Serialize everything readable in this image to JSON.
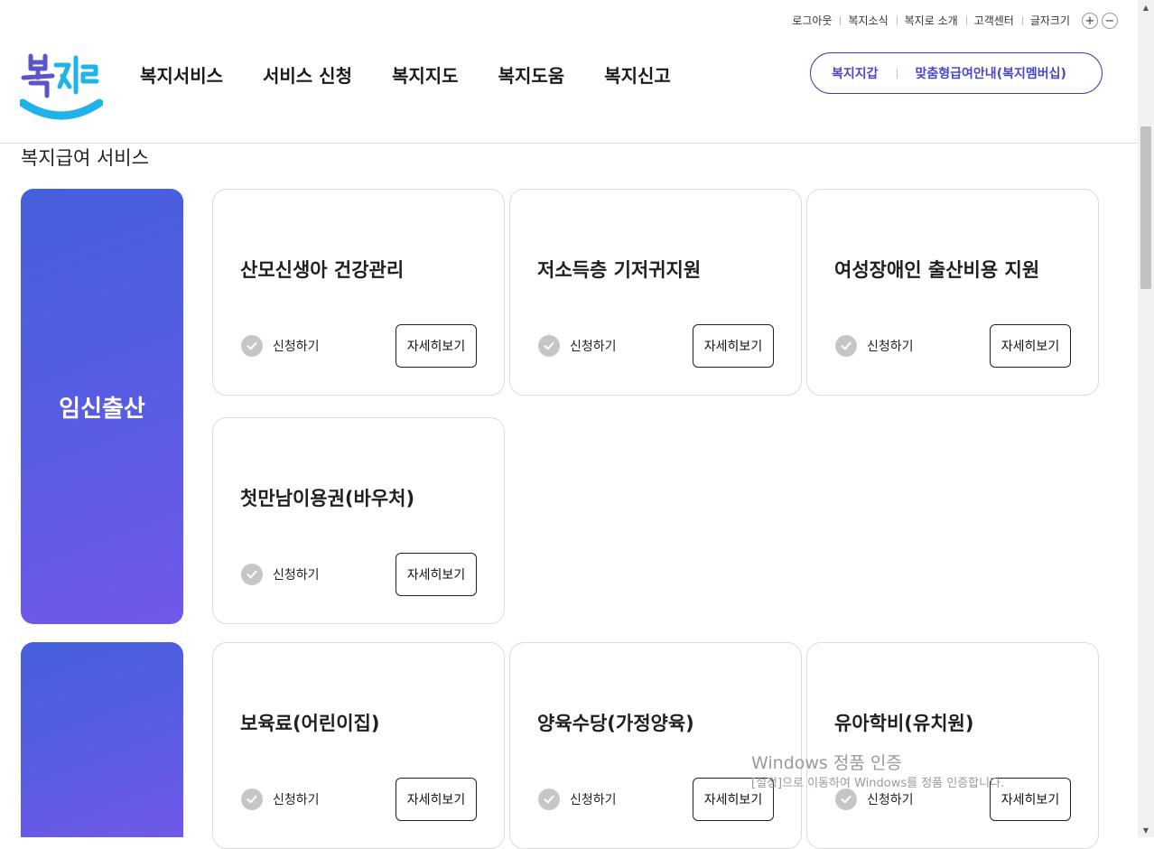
{
  "util": {
    "logout": "로그아웃",
    "news": "복지소식",
    "about": "복지로 소개",
    "support": "고객센터",
    "font_size": "글자크기",
    "plus": "+",
    "minus": "−"
  },
  "logo": {
    "text": "복지로"
  },
  "gnb": {
    "items": [
      "복지서비스",
      "서비스 신청",
      "복지지도",
      "복지도움",
      "복지신고"
    ]
  },
  "pill": {
    "wallet": "복지지갑",
    "membership": "맞춤형급여안내(복지멤버십)"
  },
  "section": {
    "title": "복지급여 서비스"
  },
  "categories": [
    {
      "name": "임신출산",
      "cards": [
        {
          "title": "산모신생아 건강관리",
          "apply": "신청하기",
          "detail": "자세히보기"
        },
        {
          "title": "저소득층 기저귀지원",
          "apply": "신청하기",
          "detail": "자세히보기"
        },
        {
          "title": "여성장애인 출산비용 지원",
          "apply": "신청하기",
          "detail": "자세히보기"
        },
        {
          "title": "첫만남이용권(바우처)",
          "apply": "신청하기",
          "detail": "자세히보기"
        }
      ]
    },
    {
      "name": "",
      "cards": [
        {
          "title": "보육료(어린이집)",
          "apply": "신청하기",
          "detail": "자세히보기"
        },
        {
          "title": "양육수당(가정양육)",
          "apply": "신청하기",
          "detail": "자세히보기"
        },
        {
          "title": "유아학비(유치원)",
          "apply": "신청하기",
          "detail": "자세히보기"
        }
      ]
    }
  ],
  "watermark": {
    "line1": "Windows 정품 인증",
    "line2": "[설정]으로 이동하여 Windows를 정품 인증합니다."
  },
  "colors": {
    "accent": "#4a48c6",
    "category_gradient_start": "#4560dc",
    "category_gradient_end": "#7158ea",
    "logo_blue": "#1fb3e8"
  }
}
